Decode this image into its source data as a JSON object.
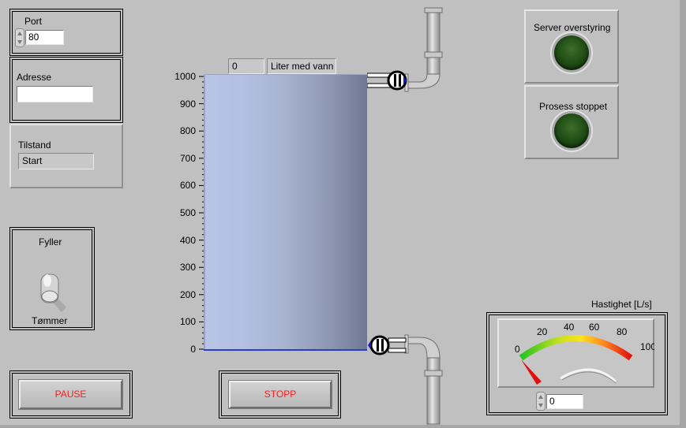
{
  "port": {
    "label": "Port",
    "value": "80"
  },
  "adresse": {
    "label": "Adresse",
    "value": ""
  },
  "tilstand": {
    "label": "Tilstand",
    "value": "Start"
  },
  "switch": {
    "top_label": "Fyller",
    "bottom_label": "Tømmer",
    "position": "down"
  },
  "buttons": {
    "pause": "PAUSE",
    "stopp": "STOPP"
  },
  "tank": {
    "value_display": "0",
    "label": "Liter med vann",
    "scale_ticks": [
      "1000",
      "900",
      "800",
      "700",
      "600",
      "500",
      "400",
      "300",
      "200",
      "100",
      "0"
    ],
    "scale_max": 1000,
    "fill_level": 0,
    "fill_color": "#b9c5e6"
  },
  "leds": {
    "server": {
      "label": "Server overstyring",
      "on": false
    },
    "prosess": {
      "label": "Prosess stoppet",
      "on": false
    }
  },
  "gauge": {
    "title": "Hastighet [L/s]",
    "ticks": [
      "0",
      "20",
      "40",
      "60",
      "80",
      "100"
    ],
    "min": 0,
    "max": 100,
    "value": 0,
    "input_value": "0"
  },
  "colors": {
    "panel": "#c0c0c0",
    "stop_text": "#ff1a1a",
    "led_off": "#1e4a14"
  }
}
